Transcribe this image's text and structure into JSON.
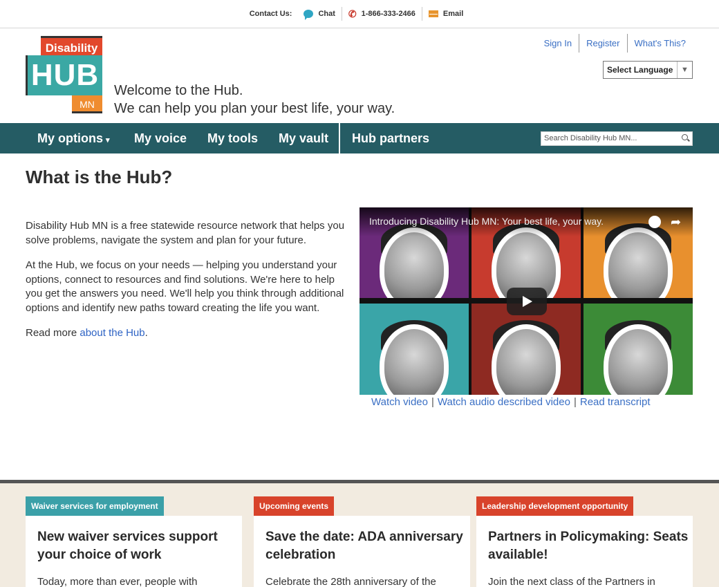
{
  "contact": {
    "label": "Contact Us:",
    "chat": "Chat",
    "phone": "1-866-333-2466",
    "email": "Email"
  },
  "logo": {
    "line1": "Disability",
    "line2": "HUB",
    "line3": "MN"
  },
  "welcome": {
    "line1": "Welcome to the Hub.",
    "line2": "We can help you plan your best life, your way."
  },
  "auth": {
    "sign_in": "Sign In",
    "register": "Register",
    "whats_this": "What's This?"
  },
  "language": {
    "label": "Select Language"
  },
  "nav": {
    "items": [
      "My options",
      "My voice",
      "My tools",
      "My vault",
      "Hub partners"
    ],
    "search_placeholder": "Search Disability Hub MN..."
  },
  "main": {
    "title": "What is the Hub?",
    "para1": "Disability Hub MN is a free statewide resource network that helps you solve problems, navigate the system and plan for your future.",
    "para2": "At the Hub, we focus on your needs — helping you understand your options, connect to resources and find solutions. We're here to help you get the answers you need. We'll help you think through additional options and identify new paths toward creating the life you want.",
    "read_more_prefix": "Read more ",
    "read_more_link": "about the Hub",
    "read_more_suffix": "."
  },
  "video": {
    "title": "Introducing Disability Hub MN: Your best life, your way.",
    "tile_colors": [
      "#6b2a7a",
      "#c73b2e",
      "#e8902e",
      "#3aa5a8",
      "#8e2a22",
      "#3c8b37"
    ],
    "links": [
      "Watch video",
      "Watch audio described video",
      "Read transcript"
    ],
    "separator": "|"
  },
  "cards": [
    {
      "tag": "Waiver services for employment",
      "tag_color": "#3ba0a8",
      "title": "New waiver services support your choice of work",
      "excerpt": "Today, more than ever, people with"
    },
    {
      "tag": "Upcoming events",
      "tag_color": "#d8432b",
      "title": "Save the date: ADA anniversary celebration",
      "excerpt": "Celebrate the 28th anniversary of the"
    },
    {
      "tag": "Leadership development opportunity",
      "tag_color": "#d8432b",
      "title": "Partners in Policymaking: Seats available!",
      "excerpt": "Join the next class of the Partners in"
    }
  ]
}
